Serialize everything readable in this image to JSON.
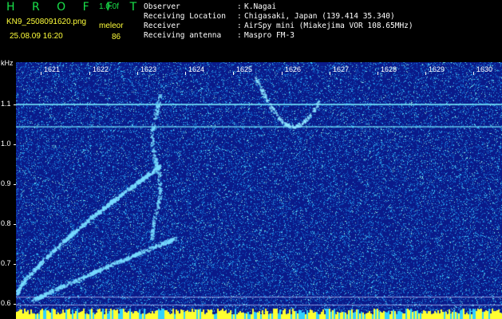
{
  "app": {
    "title": "H R O F F T",
    "version": "1.0.0f",
    "filename": "KN9_2508091620.png",
    "datetime": "25.08.09 16:20",
    "meter_label": "meleor",
    "meter_value": "86"
  },
  "station": {
    "rows": [
      {
        "key": "Observer",
        "value": "K.Nagai"
      },
      {
        "key": "Receiving Location",
        "value": "Chigasaki, Japan (139.414 35.340)"
      },
      {
        "key": "Receiver",
        "value": "AirSpy mini (Miakejima VOR 108.65MHz)"
      },
      {
        "key": "Receiving antenna",
        "value": "Maspro FM-3"
      }
    ],
    "separator": ":"
  },
  "axes": {
    "y_unit": "kHz",
    "y_ticks": [
      "1.1",
      "1.0",
      "0.9",
      "0.8",
      "0.7",
      "0.6"
    ],
    "x_ticks": [
      "1621",
      "1622",
      "1623",
      "1624",
      "1625",
      "1626",
      "1627",
      "1628",
      "1629",
      "1630"
    ]
  },
  "colors": {
    "title_green": "#19e24a",
    "label_yellow": "#ffff3a",
    "background_blue": "#0a1a8a",
    "noise_cyan": "#3fd8ff"
  }
}
